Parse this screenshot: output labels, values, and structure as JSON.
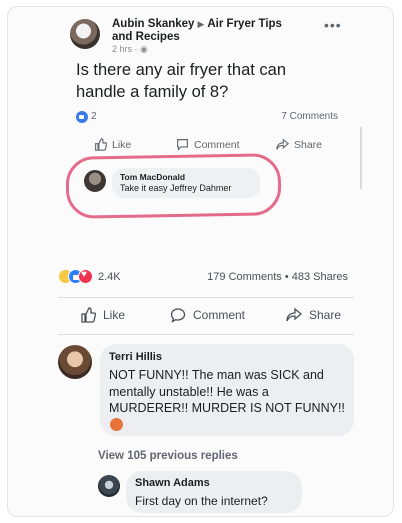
{
  "top_post": {
    "author": "Aubin Skankey",
    "group": "Air Fryer Tips and Recipes",
    "time": "2 hrs",
    "more_icon": "more-dots-icon",
    "text": "Is there any air fryer that can handle a family of 8?",
    "reaction_count": "2",
    "comments": "7 Comments",
    "actions": {
      "like": "Like",
      "comment": "Comment",
      "share": "Share"
    },
    "reply": {
      "name": "Tom MacDonald",
      "text": "Take it easy Jeffrey Dahmer"
    },
    "highlight_color": "#e46b8a"
  },
  "bottom_post": {
    "reaction_count": "2.4K",
    "stats": "179 Comments • 483 Shares",
    "actions": {
      "like": "Like",
      "comment": "Comment",
      "share": "Share"
    },
    "comment1": {
      "name": "Terri Hillis",
      "text": "NOT FUNNY!! The man was SICK and mentally unstable!! He was a MURDERER!! MURDER IS NOT FUNNY!!"
    },
    "view_replies": "View 105 previous replies",
    "comment2": {
      "name": "Shawn Adams",
      "text": "First day on the internet?"
    }
  },
  "colors": {
    "facebook_blue": "#2d7ff9",
    "love_red": "#f0344d",
    "haha_yellow": "#f7c844"
  }
}
